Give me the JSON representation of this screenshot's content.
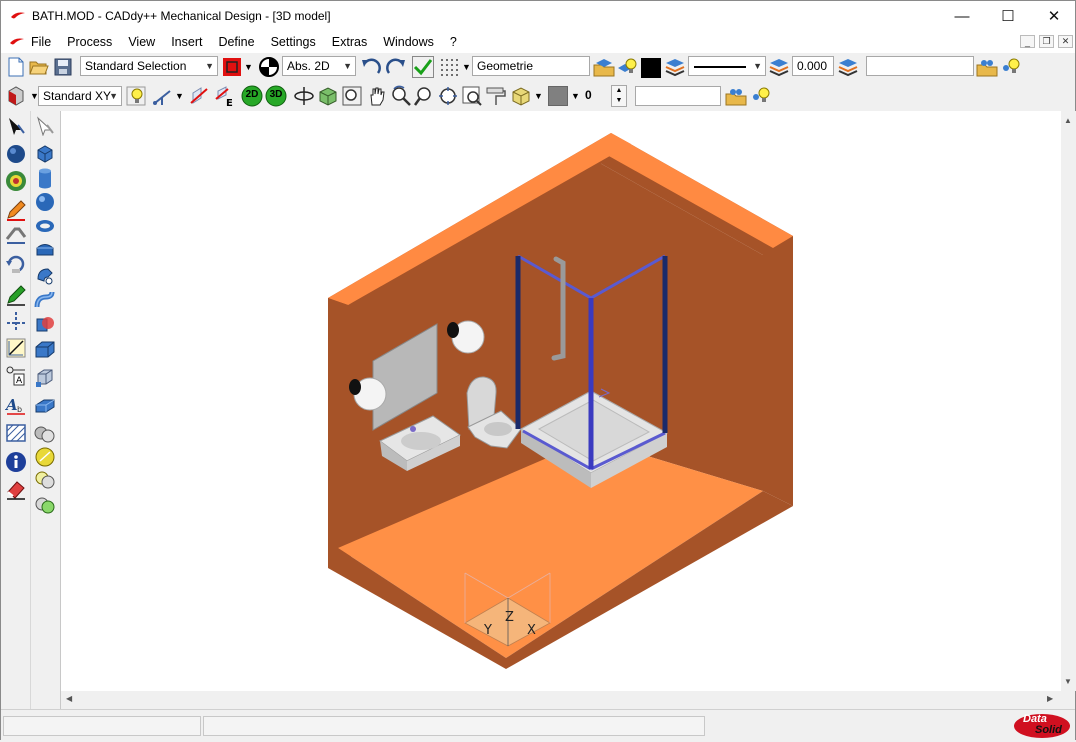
{
  "window": {
    "title": "BATH.MOD  -  CADdy++ Mechanical Design - [3D model]",
    "minimize": "—",
    "maximize": "☐",
    "close": "✕"
  },
  "menu": [
    "File",
    "Process",
    "View",
    "Insert",
    "Define",
    "Settings",
    "Extras",
    "Windows",
    "?"
  ],
  "toolbar1": {
    "selection_mode": "Standard Selection",
    "coord_mode": "Abs. 2D",
    "layer_name": "Geometrie",
    "value": "0.000",
    "extra_field": ""
  },
  "toolbar2": {
    "view_plane": "Standard XY",
    "btn_2d": "2D",
    "btn_3d": "3D",
    "counter": "0",
    "extra_field": ""
  },
  "viewport": {
    "axis_z": "Z",
    "axis_y": "Y",
    "axis_x": "X"
  },
  "brand": {
    "line1": "Data",
    "line2": "Solid"
  },
  "colors": {
    "floor": "#ff9046",
    "wall": "#a65328",
    "wall_top": "#ff8a42",
    "frame": "#5a5ad0",
    "accent_red": "#e01010"
  }
}
